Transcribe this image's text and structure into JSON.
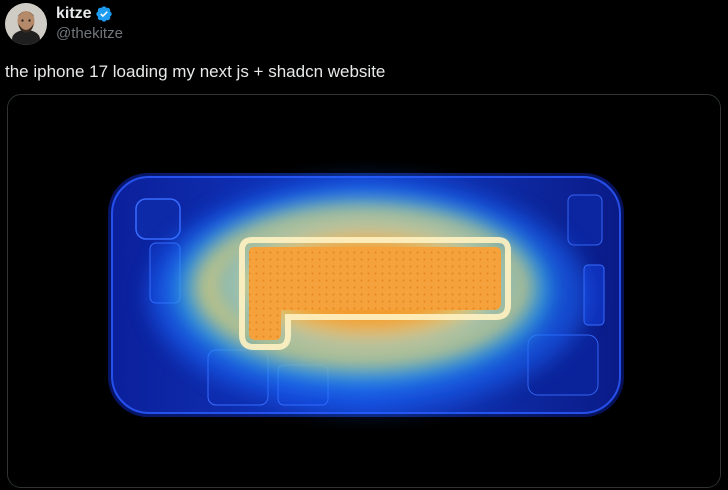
{
  "author": {
    "display_name": "kitze",
    "handle": "@thekitze",
    "verified": true,
    "verified_color": "#1d9bf0"
  },
  "tweet": {
    "text": "the iphone 17 loading my next js + shadcn website"
  },
  "media": {
    "kind": "thermal-image",
    "subject": "phone-thermal-heatmap",
    "colors": {
      "cool": "#0a1a8c",
      "mid": "#1e6bff",
      "warm": "#f2c94c",
      "hot": "#f7931e"
    }
  }
}
